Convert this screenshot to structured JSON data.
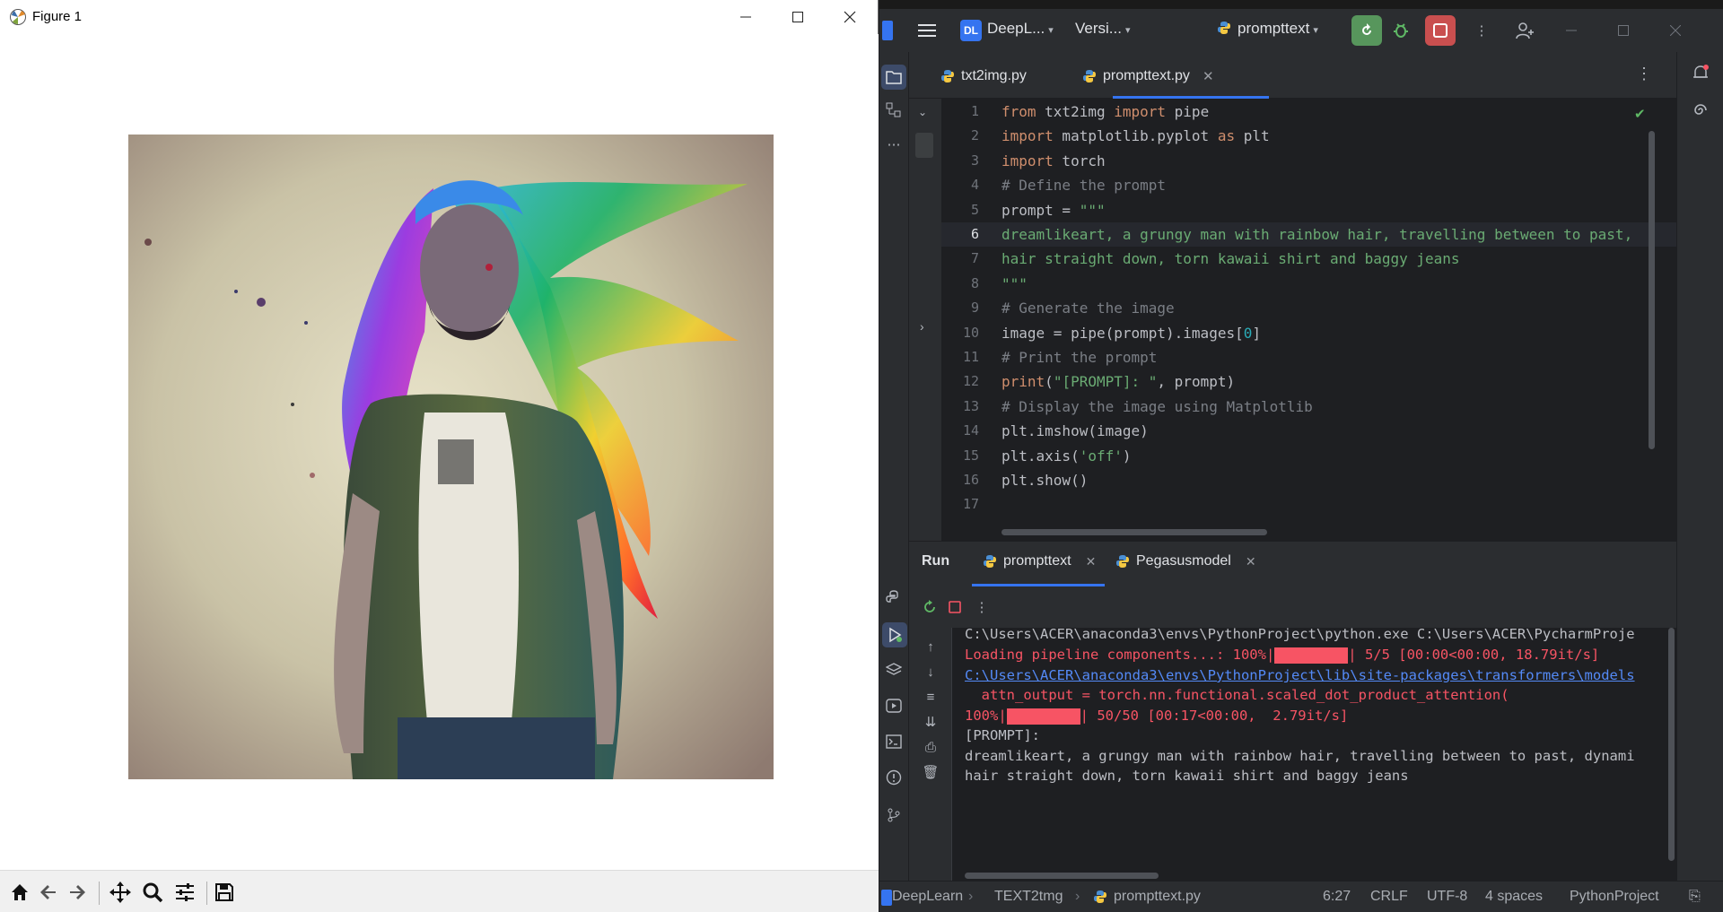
{
  "figure_window": {
    "title": "Figure 1",
    "toolbar": {
      "home": "home-icon",
      "back": "arrow-left-icon",
      "forward": "arrow-right-icon",
      "pan": "move-icon",
      "zoom": "zoom-icon",
      "configure": "sliders-icon",
      "save": "save-icon"
    }
  },
  "ide": {
    "project_badge": "DL",
    "project_name": "DeepL...",
    "vcs_label": "Versi...",
    "run_config": "prompttext",
    "colors": {
      "accent": "#3574f0",
      "run_green": "#57965c",
      "stop_red": "#c94f4f"
    },
    "editor_tabs": [
      {
        "label": "txt2img.py"
      },
      {
        "label": "prompttext.py"
      }
    ],
    "editor": {
      "current_line": 6,
      "lines": [
        "1",
        "2",
        "3",
        "4",
        "5",
        "6",
        "7",
        "8",
        "9",
        "10",
        "11",
        "12",
        "13",
        "14",
        "15",
        "16",
        "17"
      ],
      "code": {
        "l1_a": "from",
        "l1_b": " txt2img ",
        "l1_c": "import",
        "l1_d": " pipe",
        "l2_a": "import",
        "l2_b": " matplotlib.pyplot ",
        "l2_c": "as",
        "l2_d": " plt",
        "l3_a": "import",
        "l3_b": " torch",
        "l4": "# Define the prompt",
        "l5_a": "prompt = ",
        "l5_b": "\"\"\"",
        "l6": "dreamlikeart, a grungy man with rainbow hair, travelling between to past,",
        "l7": "hair straight down, torn kawaii shirt and baggy jeans",
        "l8": "\"\"\"",
        "l9": "# Generate the image",
        "l10_a": "image = pipe(prompt).images[",
        "l10_b": "0",
        "l10_c": "]",
        "l11": "# Print the prompt",
        "l12_a": "print",
        "l12_b": "(",
        "l12_c": "\"[PROMPT]: \"",
        "l12_d": ", prompt)",
        "l13": "# Display the image using Matplotlib",
        "l14": "plt.imshow(image)",
        "l15_a": "plt.axis(",
        "l15_b": "'off'",
        "l15_c": ")",
        "l16": "plt.show()"
      }
    },
    "run_panel": {
      "title": "Run",
      "tabs": [
        {
          "label": "prompttext"
        },
        {
          "label": "Pegasusmodel"
        }
      ],
      "console": {
        "line1": "C:\\Users\\ACER\\anaconda3\\envs\\PythonProject\\python.exe C:\\Users\\ACER\\PycharmProje",
        "line2_a": "Loading pipeline components...: 100%|",
        "line2_b": "| 5/5 [00:00<00:00, 18.79it/s]",
        "line3": "C:\\Users\\ACER\\anaconda3\\envs\\PythonProject\\lib\\site-packages\\transformers\\models",
        "line4": "  attn_output = torch.nn.functional.scaled_dot_product_attention(",
        "line5_a": "100%|",
        "line5_b": "| 50/50 [00:17<00:00,  2.79it/s]",
        "line6": "[PROMPT]:",
        "line7": "dreamlikeart, a grungy man with rainbow hair, travelling between to past, dynami",
        "line8": "hair straight down, torn kawaii shirt and baggy jeans"
      }
    },
    "status_bar": {
      "breadcrumb": [
        "DeepLearn",
        "TEXT2tmg",
        "prompttext.py"
      ],
      "position": "6:27",
      "line_sep": "CRLF",
      "encoding": "UTF-8",
      "indent": "4 spaces",
      "interpreter": "PythonProject"
    }
  }
}
